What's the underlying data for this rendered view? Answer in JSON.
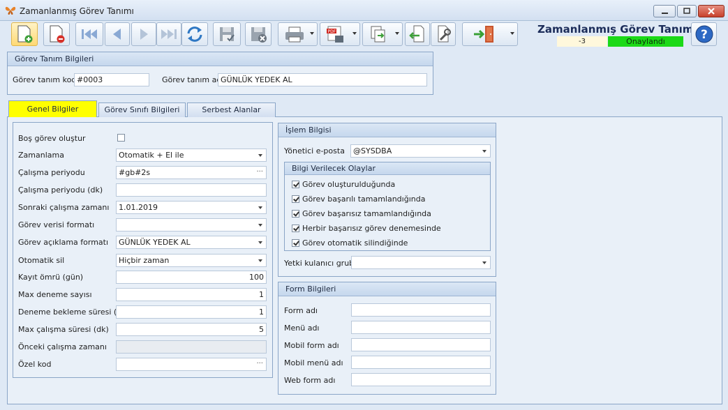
{
  "window": {
    "title": "Zamanlanmış Görev Tanımı"
  },
  "header": {
    "title": "Zamanlanmış Görev Tanımı",
    "count": "-3",
    "status": "Onaylandı"
  },
  "colors": {
    "status_green": "#1bd917",
    "active_tab": "#ffff00",
    "panel": "#e9f0f8",
    "group_border": "#8aa5c7"
  },
  "toolbar": {
    "icons": [
      "new-document-icon",
      "delete-document-icon",
      "first-record-icon",
      "previous-record-icon",
      "next-record-icon",
      "last-record-icon",
      "refresh-icon",
      "save-icon",
      "save-cancel-icon",
      "print-icon",
      "pdf-export-icon",
      "copy-export-icon",
      "import-icon",
      "settings-wrench-icon",
      "exit-door-icon",
      "help-icon"
    ]
  },
  "definition_group": {
    "title": "Görev Tanım Bilgileri",
    "code_label": "Görev tanım kodu",
    "code_value": "#0003",
    "name_label": "Görev tanım adı",
    "name_value": "GÜNLÜK YEDEK AL"
  },
  "tabs": [
    {
      "label": "Genel Bilgiler"
    },
    {
      "label": "Görev Sınıfı Bilgileri"
    },
    {
      "label": "Serbest Alanlar"
    }
  ],
  "general": {
    "create_empty_label": "Boş görev oluştur",
    "schedule_label": "Zamanlama",
    "schedule_value": "Otomatik + El ile",
    "period_label": "Çalışma periyodu",
    "period_value": "#gb#2s",
    "period_min_label": "Çalışma periyodu (dk)",
    "period_min_value": "",
    "next_run_label": "Sonraki çalışma zamanı",
    "next_run_value": "1.01.2019",
    "data_format_label": "Görev verisi formatı",
    "data_format_value": "",
    "desc_format_label": "Görev açıklama formatı",
    "desc_format_value": "GÜNLÜK YEDEK AL",
    "auto_delete_label": "Otomatik sil",
    "auto_delete_value": "Hiçbir zaman",
    "record_life_label": "Kayıt ömrü (gün)",
    "record_life_value": "100",
    "max_attempts_label": "Max deneme sayısı",
    "max_attempts_value": "1",
    "retry_wait_label": "Deneme bekleme süresi (dk)",
    "retry_wait_value": "1",
    "max_duration_label": "Max çalışma süresi (dk)",
    "max_duration_value": "5",
    "prev_run_label": "Önceki çalışma zamanı",
    "prev_run_value": "",
    "special_code_label": "Özel kod",
    "special_code_value": ""
  },
  "process": {
    "title": "İşlem Bilgisi",
    "admin_email_label": "Yönetici e-posta",
    "admin_email_value": "@SYSDBA",
    "events_title": "Bilgi Verilecek Olaylar",
    "events": [
      {
        "label": "Görev oluşturulduğunda",
        "checked": true
      },
      {
        "label": "Görev başarılı tamamlandığında",
        "checked": true
      },
      {
        "label": "Görev başarısız tamamlandığında",
        "checked": true
      },
      {
        "label": "Herbir başarısız görev denemesinde",
        "checked": true
      },
      {
        "label": "Görev otomatik silindiğinde",
        "checked": true
      }
    ],
    "auth_group_label": "Yetki kulanıcı grubu",
    "auth_group_value": ""
  },
  "form": {
    "title": "Form Bilgileri",
    "form_name_label": "Form adı",
    "menu_name_label": "Menü adı",
    "mobile_form_label": "Mobil form adı",
    "mobile_menu_label": "Mobil menü adı",
    "web_form_label": "Web form adı"
  }
}
